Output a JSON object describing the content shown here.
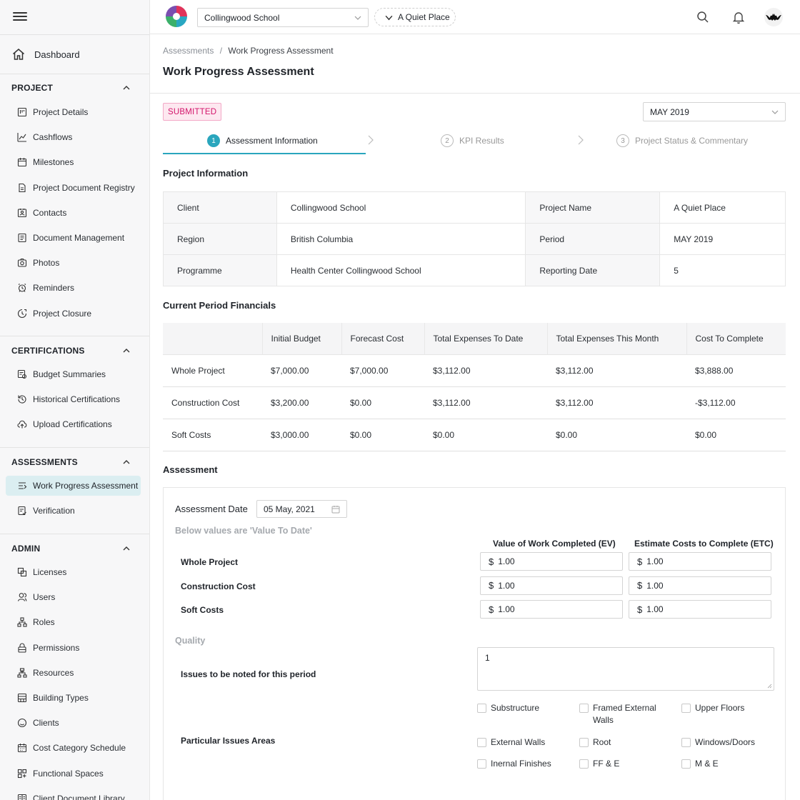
{
  "sidebar": {
    "dashboard": "Dashboard",
    "sections": [
      {
        "title": "PROJECT",
        "items": [
          "Project Details",
          "Cashflows",
          "Milestones",
          "Project Document Registry",
          "Contacts",
          "Document Management",
          "Photos",
          "Reminders",
          "Project Closure"
        ]
      },
      {
        "title": "CERTIFICATIONS",
        "items": [
          "Budget Summaries",
          "Historical Certifications",
          "Upload Certifications"
        ]
      },
      {
        "title": "ASSESSMENTS",
        "items": [
          "Work Progress Assessment",
          "Verification"
        ]
      },
      {
        "title": "ADMIN",
        "items": [
          "Licenses",
          "Users",
          "Roles",
          "Permissions",
          "Resources",
          "Building Types",
          "Clients",
          "Cost Category Schedule",
          "Functional Spaces",
          "Client Document Library"
        ]
      }
    ],
    "active_item": "Work Progress Assessment"
  },
  "topbar": {
    "client_select": "Collingwood School",
    "project_pill": "A Quiet Place"
  },
  "breadcrumb": {
    "parent": "Assessments",
    "separator": "/",
    "current": "Work Progress Assessment"
  },
  "page_title": "Work Progress Assessment",
  "status_badge": "SUBMITTED",
  "period_select": "MAY 2019",
  "steps": [
    {
      "num": "1",
      "label": "Assessment Information"
    },
    {
      "num": "2",
      "label": "KPI Results"
    },
    {
      "num": "3",
      "label": "Project Status & Commentary"
    }
  ],
  "project_info": {
    "heading": "Project Information",
    "rows": [
      {
        "l1": "Client",
        "v1": "Collingwood School",
        "l2": "Project Name",
        "v2": "A Quiet Place"
      },
      {
        "l1": "Region",
        "v1": "British Columbia",
        "l2": "Period",
        "v2": "MAY 2019"
      },
      {
        "l1": "Programme",
        "v1": "Health Center Collingwood School",
        "l2": "Reporting Date",
        "v2": "5"
      }
    ]
  },
  "financials": {
    "heading": "Current Period Financials",
    "columns": [
      "",
      "Initial Budget",
      "Forecast Cost",
      "Total Expenses To Date",
      "Total Expenses This Month",
      "Cost To Complete"
    ],
    "rows": [
      [
        "Whole Project",
        "$7,000.00",
        "$7,000.00",
        "$3,112.00",
        "$3,112.00",
        "$3,888.00"
      ],
      [
        "Construction Cost",
        "$3,200.00",
        "$0.00",
        "$3,112.00",
        "$3,112.00",
        "-$3,112.00"
      ],
      [
        "Soft Costs",
        "$3,000.00",
        "$0.00",
        "$0.00",
        "$0.00",
        "$0.00"
      ]
    ]
  },
  "assessment": {
    "heading": "Assessment",
    "date_label": "Assessment Date",
    "date_value": "05 May, 2021",
    "note": "Below values are 'Value To Date'",
    "col_ev": "Value of Work Completed (EV)",
    "col_etc": "Estimate Costs to Complete (ETC)",
    "currency": "$",
    "rows": [
      {
        "label": "Whole Project",
        "ev": "1.00",
        "etc": "1.00"
      },
      {
        "label": "Construction Cost",
        "ev": "1.00",
        "etc": "1.00"
      },
      {
        "label": "Soft Costs",
        "ev": "1.00",
        "etc": "1.00"
      }
    ],
    "quality_heading": "Quality",
    "issues_label": "Issues to be noted for this period",
    "issues_value": "1",
    "areas_label": "Particular Issues Areas",
    "areas": [
      "Substructure",
      "Framed External Walls",
      "Upper Floors",
      "External Walls",
      "Root",
      "Windows/Doors",
      "Inernal Finishes",
      "FF & E",
      "M & E"
    ]
  },
  "colors": {
    "accent": "#2aa6bd",
    "active_bg": "#dbeef1",
    "badge_text": "#d3156b",
    "badge_bg": "#fde8f0"
  }
}
